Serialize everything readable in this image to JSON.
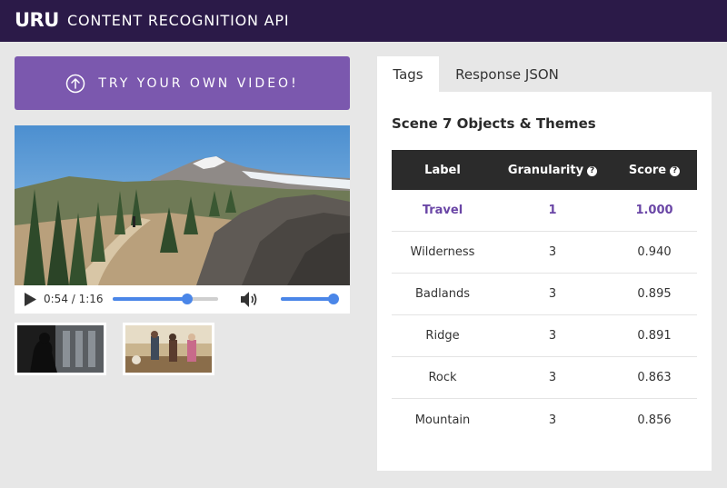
{
  "header": {
    "logo": "URU",
    "title": "CONTENT RECOGNITION API"
  },
  "upload": {
    "label": "TRY YOUR OWN VIDEO!",
    "icon": "upload-arrow-icon"
  },
  "player": {
    "time": "0:54 / 1:16",
    "progress_fraction": 0.71,
    "volume_fraction": 1.0
  },
  "tabs": [
    {
      "label": "Tags",
      "active": true
    },
    {
      "label": "Response JSON",
      "active": false
    }
  ],
  "results": {
    "title": "Scene 7 Objects & Themes",
    "columns": {
      "label": "Label",
      "granularity": "Granularity",
      "score": "Score"
    },
    "help_glyph": "?",
    "rows": [
      {
        "label": "Travel",
        "granularity": "1",
        "score": "1.000",
        "highlight": true
      },
      {
        "label": "Wilderness",
        "granularity": "3",
        "score": "0.940",
        "highlight": false
      },
      {
        "label": "Badlands",
        "granularity": "3",
        "score": "0.895",
        "highlight": false
      },
      {
        "label": "Ridge",
        "granularity": "3",
        "score": "0.891",
        "highlight": false
      },
      {
        "label": "Rock",
        "granularity": "3",
        "score": "0.863",
        "highlight": false
      },
      {
        "label": "Mountain",
        "granularity": "3",
        "score": "0.856",
        "highlight": false
      }
    ]
  },
  "colors": {
    "header_bg": "#2b1a48",
    "accent": "#7b58ae",
    "highlight_text": "#6a46a6",
    "slider": "#4a86e8",
    "table_header_bg": "#2b2b2b"
  }
}
